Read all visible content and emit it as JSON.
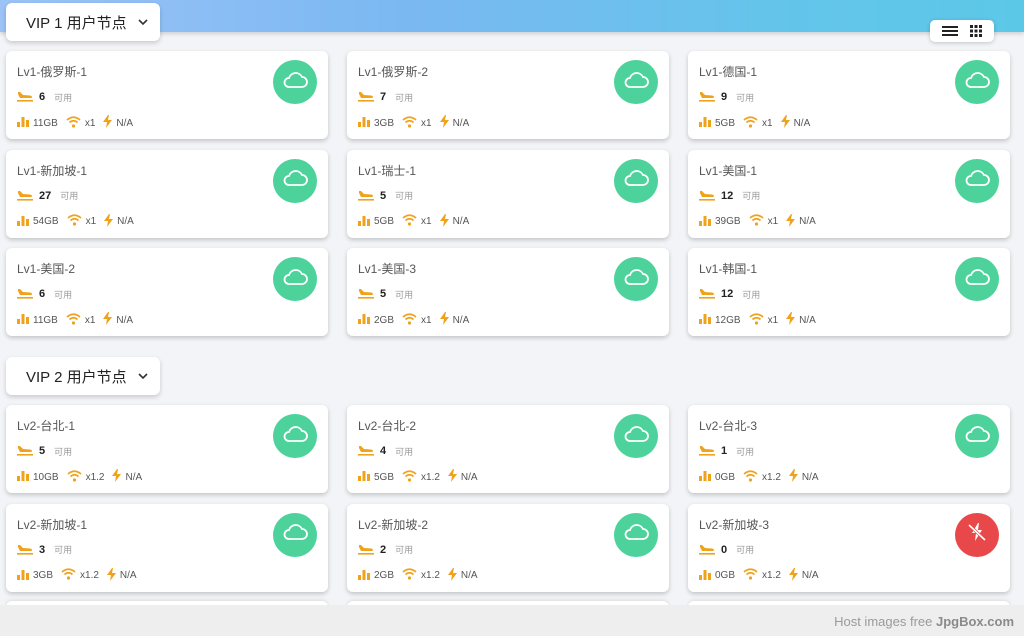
{
  "sections": [
    {
      "title": "VIP 1 用户节点"
    },
    {
      "title": "VIP 2 用户节点"
    }
  ],
  "view_toggle": {
    "list_icon": "list-icon",
    "grid_icon": "grid-icon"
  },
  "avail_label": "可用",
  "colors": {
    "online": "#4cd29a",
    "offline": "#e8484a",
    "icon_accent": "#f0a21b"
  },
  "vip1_nodes": [
    {
      "name": "Lv1-俄罗斯-1",
      "count": "6",
      "traffic": "11GB",
      "ratio": "x1",
      "speed": "N/A",
      "status": "online"
    },
    {
      "name": "Lv1-俄罗斯-2",
      "count": "7",
      "traffic": "3GB",
      "ratio": "x1",
      "speed": "N/A",
      "status": "online"
    },
    {
      "name": "Lv1-德国-1",
      "count": "9",
      "traffic": "5GB",
      "ratio": "x1",
      "speed": "N/A",
      "status": "online"
    },
    {
      "name": "Lv1-新加坡-1",
      "count": "27",
      "traffic": "54GB",
      "ratio": "x1",
      "speed": "N/A",
      "status": "online"
    },
    {
      "name": "Lv1-瑞士-1",
      "count": "5",
      "traffic": "5GB",
      "ratio": "x1",
      "speed": "N/A",
      "status": "online"
    },
    {
      "name": "Lv1-美国-1",
      "count": "12",
      "traffic": "39GB",
      "ratio": "x1",
      "speed": "N/A",
      "status": "online"
    },
    {
      "name": "Lv1-美国-2",
      "count": "6",
      "traffic": "11GB",
      "ratio": "x1",
      "speed": "N/A",
      "status": "online"
    },
    {
      "name": "Lv1-美国-3",
      "count": "5",
      "traffic": "2GB",
      "ratio": "x1",
      "speed": "N/A",
      "status": "online"
    },
    {
      "name": "Lv1-韩国-1",
      "count": "12",
      "traffic": "12GB",
      "ratio": "x1",
      "speed": "N/A",
      "status": "online"
    }
  ],
  "vip2_nodes": [
    {
      "name": "Lv2-台北-1",
      "count": "5",
      "traffic": "10GB",
      "ratio": "x1.2",
      "speed": "N/A",
      "status": "online"
    },
    {
      "name": "Lv2-台北-2",
      "count": "4",
      "traffic": "5GB",
      "ratio": "x1.2",
      "speed": "N/A",
      "status": "online"
    },
    {
      "name": "Lv2-台北-3",
      "count": "1",
      "traffic": "0GB",
      "ratio": "x1.2",
      "speed": "N/A",
      "status": "online"
    },
    {
      "name": "Lv2-新加坡-1",
      "count": "3",
      "traffic": "3GB",
      "ratio": "x1.2",
      "speed": "N/A",
      "status": "online"
    },
    {
      "name": "Lv2-新加坡-2",
      "count": "2",
      "traffic": "2GB",
      "ratio": "x1.2",
      "speed": "N/A",
      "status": "online"
    },
    {
      "name": "Lv2-新加坡-3",
      "count": "0",
      "traffic": "0GB",
      "ratio": "x1.2",
      "speed": "N/A",
      "status": "offline"
    }
  ],
  "footer": {
    "prefix": "Host images free",
    "brand": "JpgBox.com"
  }
}
